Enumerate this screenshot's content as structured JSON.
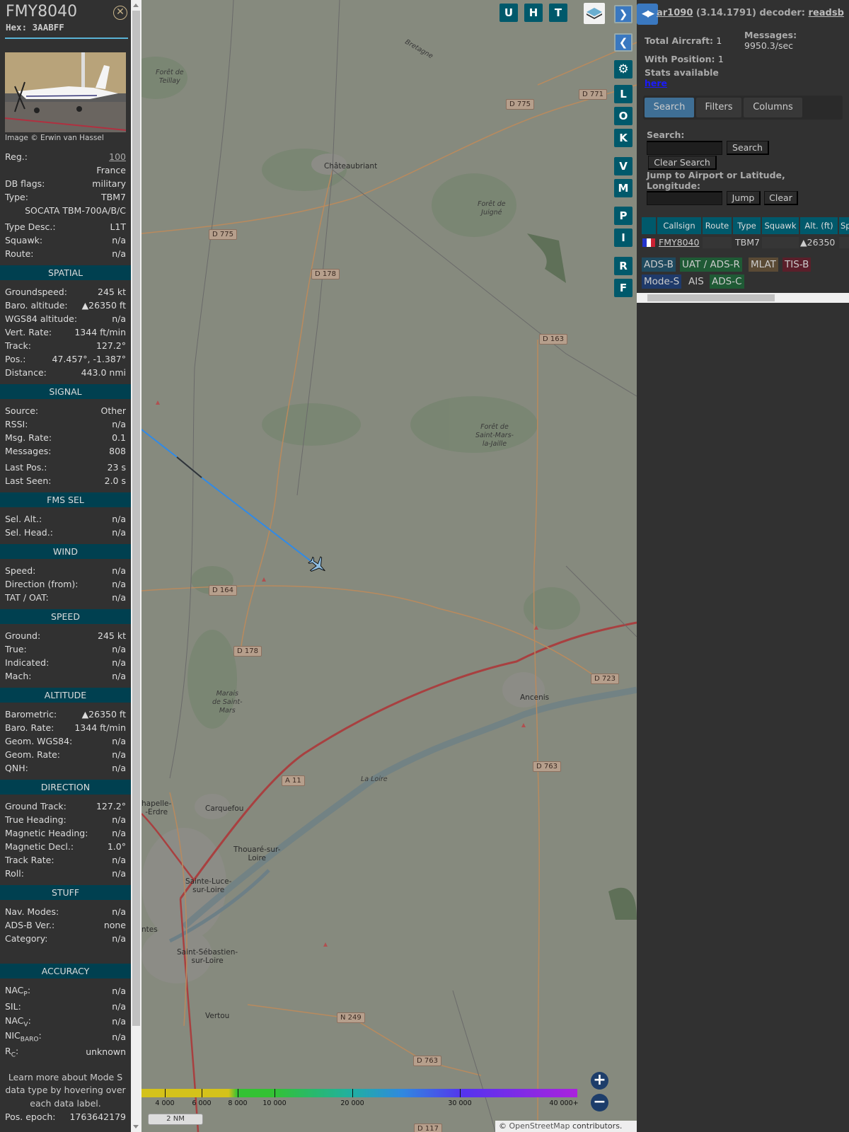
{
  "aircraft": {
    "callsign": "FMY8040",
    "hex_label": "Hex:",
    "hex": "3AABFF",
    "image_caption": "Image © Erwin van Hassel",
    "close_icon": "close-circle-icon"
  },
  "details": [
    {
      "type": "row",
      "label": "Reg.:",
      "value": "100",
      "link": true
    },
    {
      "type": "single",
      "value": "France"
    },
    {
      "type": "row",
      "label": "DB flags:",
      "value": "military"
    },
    {
      "type": "row",
      "label": "Type:",
      "value": "TBM7"
    },
    {
      "type": "single",
      "value": "SOCATA TBM-700A/B/C"
    },
    {
      "type": "row",
      "label": "Type Desc.:",
      "value": "L1T",
      "mt": true
    },
    {
      "type": "row",
      "label": "Squawk:",
      "value": "n/a"
    },
    {
      "type": "row",
      "label": "Route:",
      "value": "n/a"
    },
    {
      "type": "sec",
      "label": "SPATIAL"
    },
    {
      "type": "row",
      "label": "Groundspeed:",
      "value": "245 kt"
    },
    {
      "type": "row",
      "label": "Baro. altitude:",
      "value": "▲26350 ft"
    },
    {
      "type": "row",
      "label": "WGS84 altitude:",
      "value": "n/a"
    },
    {
      "type": "row",
      "label": "Vert. Rate:",
      "value": "1344 ft/min"
    },
    {
      "type": "row",
      "label": "Track:",
      "value": "127.2°"
    },
    {
      "type": "row",
      "label": "Pos.:",
      "value": "47.457°, -1.387°"
    },
    {
      "type": "row",
      "label": "Distance:",
      "value": "443.0 nmi"
    },
    {
      "type": "sec",
      "label": "SIGNAL"
    },
    {
      "type": "row",
      "label": "Source:",
      "value": "Other"
    },
    {
      "type": "row",
      "label": "RSSI:",
      "value": "n/a"
    },
    {
      "type": "row",
      "label": "Msg. Rate:",
      "value": "0.1"
    },
    {
      "type": "row",
      "label": "Messages:",
      "value": "808"
    },
    {
      "type": "row",
      "label": "Last Pos.:",
      "value": "23 s",
      "mt": true
    },
    {
      "type": "row",
      "label": "Last Seen:",
      "value": "2.0 s"
    },
    {
      "type": "sec",
      "label": "FMS SEL"
    },
    {
      "type": "row",
      "label": "Sel. Alt.:",
      "value": "n/a"
    },
    {
      "type": "row",
      "label": "Sel. Head.:",
      "value": "n/a"
    },
    {
      "type": "sec",
      "label": "WIND"
    },
    {
      "type": "row",
      "label": "Speed:",
      "value": "n/a"
    },
    {
      "type": "row",
      "label": "Direction (from):",
      "value": "n/a"
    },
    {
      "type": "row",
      "label": "TAT / OAT:",
      "value": "n/a"
    },
    {
      "type": "sec",
      "label": "SPEED"
    },
    {
      "type": "row",
      "label": "Ground:",
      "value": "245 kt"
    },
    {
      "type": "row",
      "label": "True:",
      "value": "n/a"
    },
    {
      "type": "row",
      "label": "Indicated:",
      "value": "n/a"
    },
    {
      "type": "row",
      "label": "Mach:",
      "value": "n/a"
    },
    {
      "type": "sec",
      "label": "ALTITUDE"
    },
    {
      "type": "row",
      "label": "Barometric:",
      "value": "▲26350 ft"
    },
    {
      "type": "row",
      "label": "Baro. Rate:",
      "value": "1344 ft/min"
    },
    {
      "type": "row",
      "label": "Geom. WGS84:",
      "value": "n/a"
    },
    {
      "type": "row",
      "label": "Geom. Rate:",
      "value": "n/a"
    },
    {
      "type": "row",
      "label": "QNH:",
      "value": "n/a"
    },
    {
      "type": "sec",
      "label": "DIRECTION"
    },
    {
      "type": "row",
      "label": "Ground Track:",
      "value": "127.2°"
    },
    {
      "type": "row",
      "label": "True Heading:",
      "value": "n/a"
    },
    {
      "type": "row",
      "label": "Magnetic Heading:",
      "value": "n/a"
    },
    {
      "type": "row",
      "label": "Magnetic Decl.:",
      "value": "1.0°"
    },
    {
      "type": "row",
      "label": "Track Rate:",
      "value": "n/a"
    },
    {
      "type": "row",
      "label": "Roll:",
      "value": "n/a"
    },
    {
      "type": "sec",
      "label": "STUFF"
    },
    {
      "type": "row",
      "label": "Nav. Modes:",
      "value": "n/a"
    },
    {
      "type": "row",
      "label": "ADS-B Ver.:",
      "value": "none"
    },
    {
      "type": "row",
      "label": "Category:",
      "value": "n/a"
    },
    {
      "type": "blank"
    },
    {
      "type": "sec",
      "label": "ACCURACY"
    },
    {
      "type": "row",
      "label": "NAC",
      "sub": "P",
      "label_end": ":",
      "value": "n/a",
      "tall": true
    },
    {
      "type": "row",
      "label": "SIL:",
      "value": "n/a",
      "tall": true
    },
    {
      "type": "row",
      "label": "NAC",
      "sub": "V",
      "label_end": ":",
      "value": "n/a",
      "tall": true
    },
    {
      "type": "row",
      "label": "NIC",
      "sub": "BARO",
      "label_end": ":",
      "value": "n/a",
      "tall": true
    },
    {
      "type": "row",
      "label": "R",
      "sub": "C",
      "label_end": ":",
      "value": "unknown",
      "tall": true
    },
    {
      "type": "learn",
      "value": "Learn more about Mode S data type by hovering over each data label."
    },
    {
      "type": "row",
      "label": "Pos. epoch:",
      "value": "1763642179"
    }
  ],
  "map": {
    "top_buttons": [
      "U",
      "H",
      "T"
    ],
    "side_buttons": [
      "L",
      "O",
      "K",
      "V",
      "M",
      "P",
      "I",
      "R",
      "F"
    ],
    "places": [
      {
        "name": "Châteaubriant",
        "cls": ""
      },
      {
        "name": "Ancenis",
        "cls": ""
      },
      {
        "name": "Carquefou",
        "cls": ""
      },
      {
        "name": "Thouaré-sur-\nLoire",
        "cls": ""
      },
      {
        "name": "Sainte-Luce-\nsur-Loire",
        "cls": ""
      },
      {
        "name": "Saint-Sébastien-\nsur-Loire",
        "cls": ""
      },
      {
        "name": "Vertou",
        "cls": ""
      },
      {
        "name": "hapelle-\n-Erdre",
        "cls": ""
      },
      {
        "name": "ntes",
        "cls": ""
      },
      {
        "name": "Forêt de\nTeillay",
        "cls": "it"
      },
      {
        "name": "Forêt de\nJuigné",
        "cls": "it"
      },
      {
        "name": "Forêt de\nSaint-Mars-\nla-Jaille",
        "cls": "it"
      },
      {
        "name": "Marais\nde Saint-\nMars",
        "cls": "it"
      },
      {
        "name": "La Loire",
        "cls": "it"
      },
      {
        "name": "Bretagne",
        "cls": "it"
      }
    ],
    "roads": [
      "D 771",
      "D 775",
      "D 775",
      "D 178",
      "D 163",
      "D 164",
      "D 178",
      "D 723",
      "D 763",
      "A 11",
      "N 249",
      "D 763",
      "D 117"
    ],
    "legend": {
      "ticks": [
        "4 000",
        "6 000",
        "8 000",
        "10 000",
        "20 000",
        "30 000",
        "40 000+"
      ],
      "scale": "2 NM"
    },
    "zoom_in": "+",
    "zoom_out": "−",
    "attribution_prefix": "© ",
    "attribution_link": "OpenStreetMap",
    "attribution_suffix": " contributors."
  },
  "right": {
    "header_app": "ar1090",
    "header_version": " (3.14.1791) decoder: ",
    "header_decoder": "readsb",
    "total_aircraft_label": "Total Aircraft:",
    "total_aircraft": "1",
    "messages_label": "Messages:",
    "messages_rate": "9950.3/sec",
    "with_position_label": "With Position:",
    "with_position": "1",
    "stats_label": "Stats available",
    "stats_link": "here",
    "tabs": [
      "Search",
      "Filters",
      "Columns"
    ],
    "search_label": "Search:",
    "search_value": "",
    "search_button": "Search",
    "clear_search_button": "Clear Search",
    "jump_label_1": "Jump to Airport or Latitude,",
    "jump_label_2": "Longitude:",
    "jump_value": "",
    "jump_button": "Jump",
    "clear_button": "Clear",
    "table": {
      "columns": [
        "",
        "Callsign",
        "Route",
        "Type",
        "Squawk",
        "Alt. (ft)",
        "Sp"
      ],
      "rows": [
        {
          "flag": "France",
          "callsign": "FMY8040",
          "route": "",
          "type": "TBM7",
          "squawk": "",
          "alt": "▲26350"
        }
      ]
    },
    "badges": [
      {
        "label": "ADS-B",
        "color": "#1f4a5f"
      },
      {
        "label": "UAT / ADS-R",
        "color": "#1f5a35"
      },
      {
        "label": "MLAT",
        "color": "#5a4a35"
      },
      {
        "label": "TIS-B",
        "color": "#5a1f2a"
      },
      {
        "label": "Mode-S",
        "color": "#1f3a6a"
      },
      {
        "label": "AIS",
        "color": "#313131"
      },
      {
        "label": "ADS-C",
        "color": "#1f5a35"
      }
    ]
  }
}
